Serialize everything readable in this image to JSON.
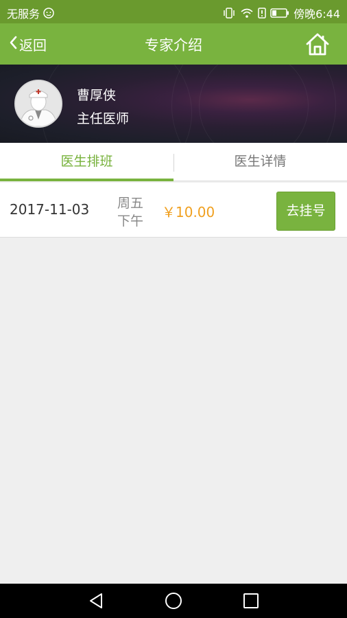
{
  "status_bar": {
    "carrier": "无服务",
    "time": "傍晚6:44"
  },
  "nav": {
    "back_label": "返回",
    "title": "专家介绍"
  },
  "profile": {
    "name": "曹厚侠",
    "title": "主任医师"
  },
  "tabs": [
    {
      "label": "医生排班",
      "active": true
    },
    {
      "label": "医生详情",
      "active": false
    }
  ],
  "schedule": [
    {
      "date": "2017-11-03",
      "weekday": "周五",
      "period": "下午",
      "price": "￥10.00",
      "action": "去挂号"
    }
  ],
  "colors": {
    "accent": "#79b33f",
    "price": "#f0a020",
    "status_bar": "#6a9a2e"
  },
  "icons": {
    "back": "chevron-left-icon",
    "home": "home-icon",
    "sys_back": "triangle-back-icon",
    "sys_home": "circle-home-icon",
    "sys_recent": "square-recent-icon"
  }
}
